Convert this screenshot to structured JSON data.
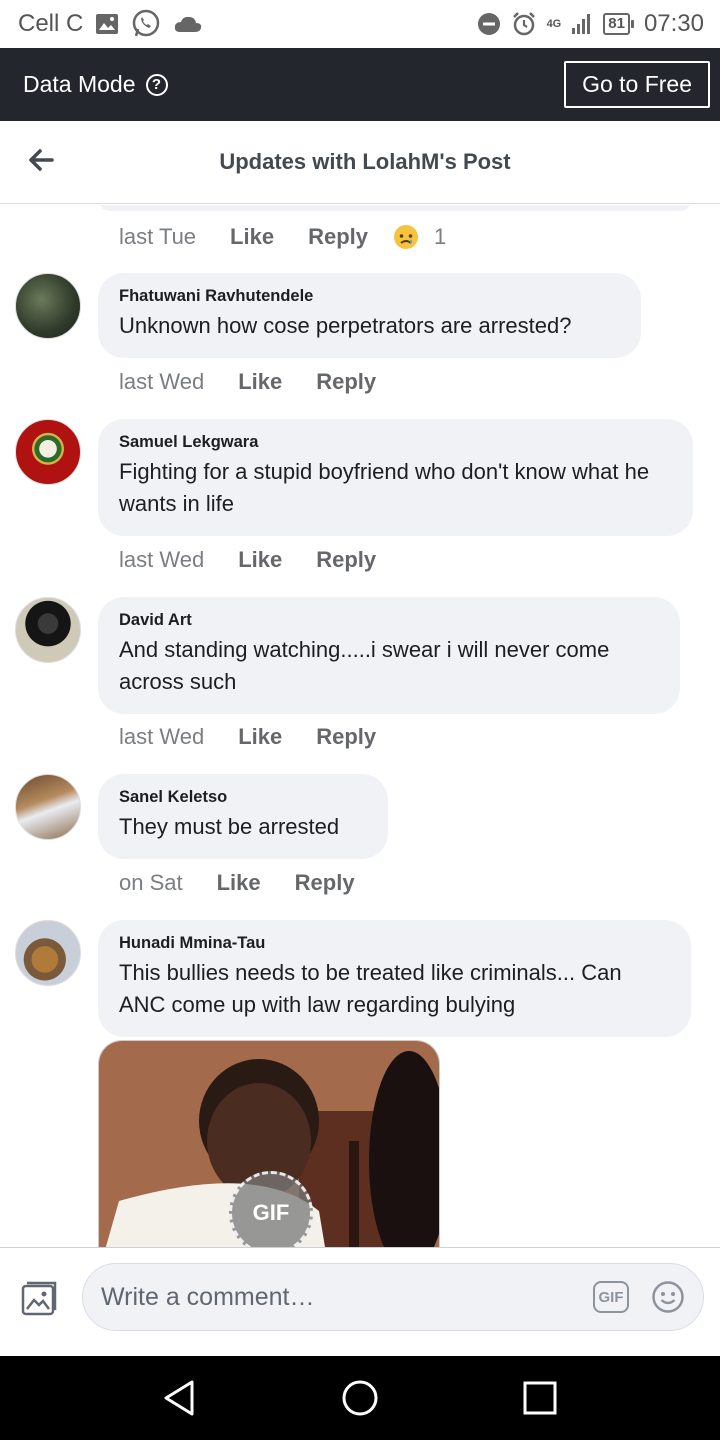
{
  "status_bar": {
    "carrier": "Cell C",
    "network": "4G",
    "battery": "81",
    "time": "07:30"
  },
  "data_bar": {
    "label": "Data Mode",
    "help": "?",
    "go_free": "Go to Free",
    "background": "#23262d"
  },
  "header": {
    "title": "Updates with LolahM's Post"
  },
  "first_meta": {
    "time": "last Tue",
    "like": "Like",
    "reply": "Reply",
    "reaction_count": "1"
  },
  "comments": [
    {
      "name": "Fhatuwani Ravhutendele",
      "text": "Unknown how cose perpetrators are arrested?",
      "time": "last Wed",
      "like": "Like",
      "reply": "Reply"
    },
    {
      "name": "Samuel Lekgwara",
      "text": "Fighting for a stupid boyfriend who don't know what he wants in life",
      "time": "last Wed",
      "like": "Like",
      "reply": "Reply"
    },
    {
      "name": "David Art",
      "text": "And standing watching.....i swear i will never come across such",
      "time": "last Wed",
      "like": "Like",
      "reply": "Reply"
    },
    {
      "name": "Sanel Keletso",
      "text": "They must be arrested",
      "time": "on Sat",
      "like": "Like",
      "reply": "Reply"
    },
    {
      "name": "Hunadi Mmina-Tau",
      "text": "This bullies needs to be treated like criminals... Can ANC come up with law regarding bulying",
      "gif_label": "GIF"
    }
  ],
  "composer": {
    "placeholder": "Write a comment…",
    "gif": "GIF"
  },
  "colors": {
    "bubble": "#f0f2f5",
    "nav": "#000000"
  }
}
